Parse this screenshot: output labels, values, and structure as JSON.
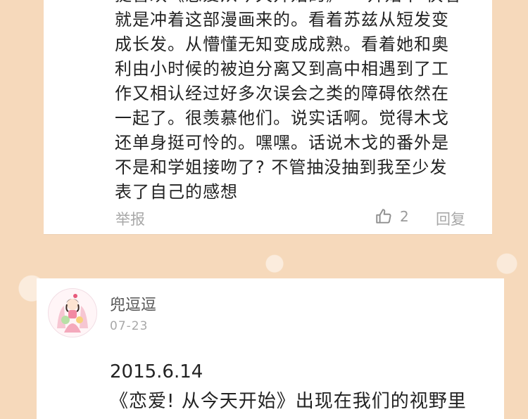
{
  "comment_top": {
    "lines": [
      "挺喜欢《恋爱从今天开始的》 一开始下 快看",
      "就是冲着这部漫画来的。看着苏兹从短发变",
      "成长发。从懵懂无知变成成熟。看着她和奥",
      "利由小时候的被迫分离又到高中相遇到了工",
      "作又相认经过好多次误会之类的障碍依然在",
      "一起了。很羡慕他们。说实话啊。觉得木戈",
      "还单身挺可怜的。嘿嘿。话说木戈的番外是",
      "不是和学姐接吻了? 不管抽没抽到我至少发",
      "表了自己的感想"
    ],
    "report_label": "举报",
    "like_icon": "thumbs-up-icon",
    "like_count": "2",
    "reply_label": "回复"
  },
  "comment_bottom": {
    "avatar_icon": "girl-avatar-icon",
    "username": "兜逗逗",
    "date": "07-23",
    "text_line1": "2015.6.14",
    "text_line2": "《恋爱! 从今天开始》出现在我们的视野里"
  },
  "colors": {
    "background": "#f6d9bb",
    "card": "#ffffff",
    "muted_text": "#a8a8a8"
  }
}
